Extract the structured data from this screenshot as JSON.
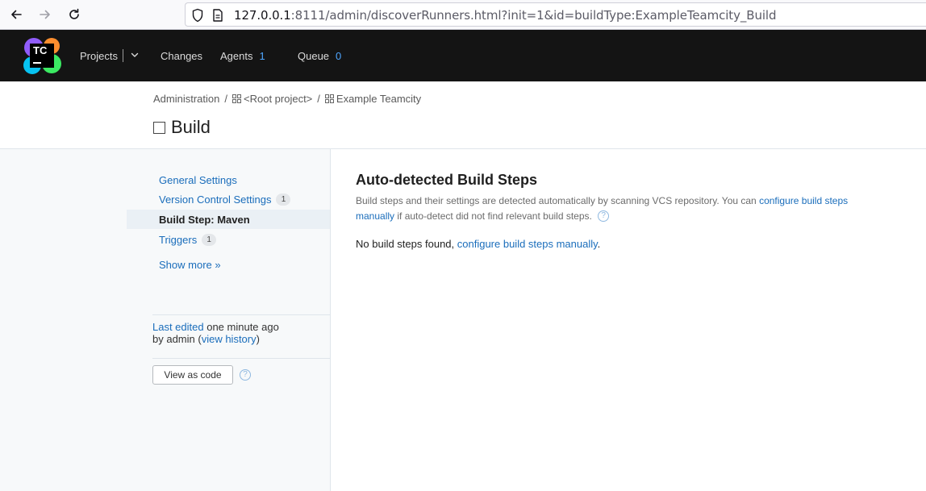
{
  "browser": {
    "url_host": "127.0.0.1",
    "url_rest": ":8111/admin/discoverRunners.html?init=1&id=buildType:ExampleTeamcity_Build"
  },
  "header": {
    "logo_text": "TC",
    "projects_label": "Projects",
    "changes_label": "Changes",
    "agents_label": "Agents",
    "agents_count": "1",
    "queue_label": "Queue",
    "queue_count": "0"
  },
  "breadcrumb": {
    "admin": "Administration",
    "root": "<Root project>",
    "project": "Example Teamcity",
    "separator": "/"
  },
  "page_title": "Build",
  "sidebar": {
    "items": [
      {
        "label": "General Settings",
        "badge": ""
      },
      {
        "label": "Version Control Settings",
        "badge": "1"
      },
      {
        "label": "Build Step: Maven",
        "badge": ""
      },
      {
        "label": "Triggers",
        "badge": "1"
      }
    ],
    "show_more": "Show more »",
    "last_edited_link": "Last edited",
    "last_edited_time": " one minute ago",
    "by_admin": "by admin  (",
    "view_history": "view history",
    "close_paren": ")",
    "view_as_code": "View as code"
  },
  "main": {
    "heading": "Auto-detected Build Steps",
    "desc_part1": "Build steps and their settings are detected automatically by scanning VCS repository. You can ",
    "desc_link": "configure build steps manually",
    "desc_part2": " if auto-detect did not find relevant build steps.",
    "msg_part1": "No build steps found, ",
    "msg_link": "configure build steps manually",
    "msg_part2": "."
  },
  "colors": {
    "header_bg": "#141414",
    "link": "#1a6dbb",
    "count": "#4ea6ff",
    "active_bg": "#eaf0f5"
  },
  "icons": [
    "back-arrow-icon",
    "forward-arrow-icon",
    "reload-icon",
    "shield-icon",
    "page-icon",
    "chevron-down-icon",
    "project-grid-icon",
    "help-icon"
  ]
}
